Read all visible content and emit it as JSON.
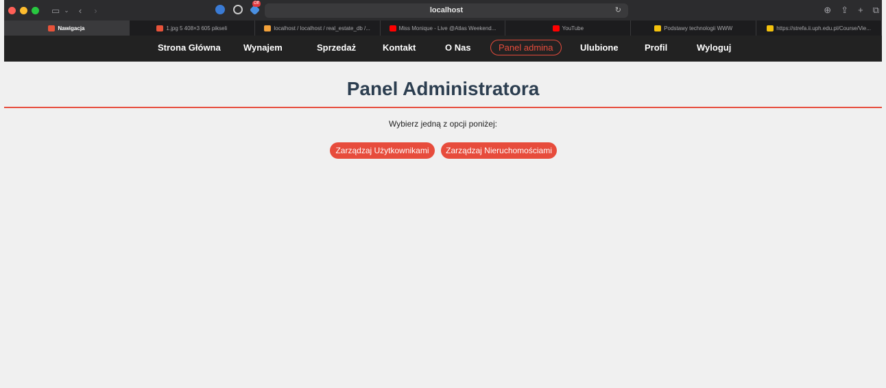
{
  "browser": {
    "url": "localhost",
    "extension_badge": "Off",
    "tabs": [
      {
        "label": "Nawigacja",
        "active": true,
        "favicon_color": "#e8533a"
      },
      {
        "label": "1.jpg 5 408×3 605 pikseli",
        "active": false,
        "favicon_color": "#e8533a"
      },
      {
        "label": "localhost / localhost / real_estate_db /...",
        "active": false,
        "favicon_color": "#f2a13a"
      },
      {
        "label": "Miss Monique - Live @Atlas Weekend...",
        "active": false,
        "favicon_color": "#ff0000"
      },
      {
        "label": "YouTube",
        "active": false,
        "favicon_color": "#ff0000"
      },
      {
        "label": "Podstawy technologii WWW",
        "active": false,
        "favicon_color": "#f4c20d"
      },
      {
        "label": "https://strefa.ii.uph.edu.pl/Course/Vie...",
        "active": false,
        "favicon_color": "#f4c20d"
      }
    ]
  },
  "nav": {
    "items": [
      {
        "label": "Strona Główna",
        "active": false
      },
      {
        "label": "Wynajem",
        "active": false
      },
      {
        "label": "Sprzedaż",
        "active": false
      },
      {
        "label": "Kontakt",
        "active": false
      },
      {
        "label": "O Nas",
        "active": false
      },
      {
        "label": "Panel admina",
        "active": true
      },
      {
        "label": "Ulubione",
        "active": false
      },
      {
        "label": "Profil",
        "active": false
      },
      {
        "label": "Wyloguj",
        "active": false
      }
    ]
  },
  "main": {
    "title": "Panel Administratora",
    "subtitle": "Wybierz jedną z opcji poniżej:",
    "buttons": [
      {
        "label": "Zarządzaj Użytkownikami"
      },
      {
        "label": "Zarządzaj Nieruchomościami"
      }
    ]
  },
  "colors": {
    "accent": "#e74c3c",
    "title": "#2c3e50",
    "nav_bg": "#222222",
    "page_bg": "#f0f0f0"
  }
}
